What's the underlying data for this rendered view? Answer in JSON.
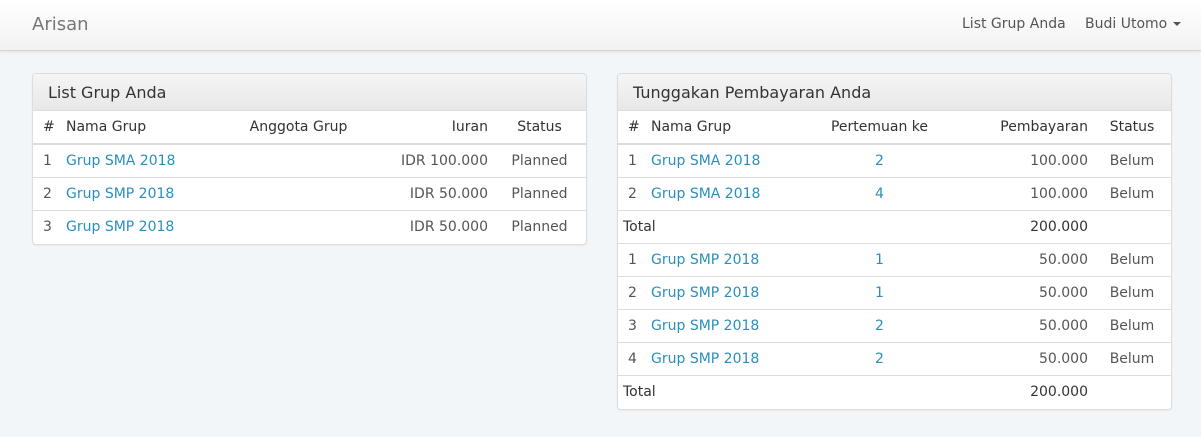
{
  "navbar": {
    "brand": "Arisan",
    "groups_link": "List Grup Anda",
    "user_menu": "Budi Utomo"
  },
  "groups_panel": {
    "title": "List Grup Anda",
    "columns": [
      "#",
      "Nama Grup",
      "Anggota Grup",
      "Iuran",
      "Status"
    ],
    "rows": [
      {
        "no": "1",
        "name": "Grup SMA 2018",
        "members": "",
        "fee": "IDR 100.000",
        "status": "Planned"
      },
      {
        "no": "2",
        "name": "Grup SMP 2018",
        "members": "",
        "fee": "IDR 50.000",
        "status": "Planned"
      },
      {
        "no": "3",
        "name": "Grup SMP 2018",
        "members": "",
        "fee": "IDR 50.000",
        "status": "Planned"
      }
    ]
  },
  "arrears_panel": {
    "title": "Tunggakan Pembayaran Anda",
    "columns": [
      "#",
      "Nama Grup",
      "Pertemuan ke",
      "Pembayaran",
      "Status"
    ],
    "total_label": "Total",
    "sections": [
      {
        "rows": [
          {
            "no": "1",
            "name": "Grup SMA 2018",
            "meeting": "2",
            "payment": "100.000",
            "status": "Belum"
          },
          {
            "no": "2",
            "name": "Grup SMA 2018",
            "meeting": "4",
            "payment": "100.000",
            "status": "Belum"
          }
        ],
        "total": "200.000"
      },
      {
        "rows": [
          {
            "no": "1",
            "name": "Grup SMP 2018",
            "meeting": "1",
            "payment": "50.000",
            "status": "Belum"
          },
          {
            "no": "2",
            "name": "Grup SMP 2018",
            "meeting": "1",
            "payment": "50.000",
            "status": "Belum"
          },
          {
            "no": "3",
            "name": "Grup SMP 2018",
            "meeting": "2",
            "payment": "50.000",
            "status": "Belum"
          },
          {
            "no": "4",
            "name": "Grup SMP 2018",
            "meeting": "2",
            "payment": "50.000",
            "status": "Belum"
          }
        ],
        "total": "200.000"
      }
    ]
  }
}
